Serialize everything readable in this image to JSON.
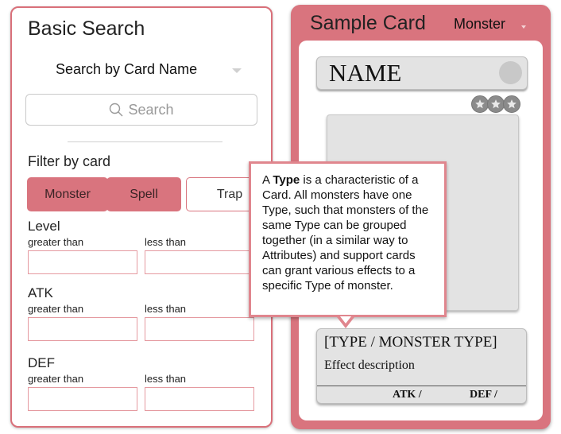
{
  "search_panel": {
    "title": "Basic Search",
    "search_mode": "Search by Card Name",
    "search_placeholder": "Search",
    "filter_label": "Filter by card",
    "filters": [
      {
        "label": "Monster",
        "active": true
      },
      {
        "label": "Spell",
        "active": true
      },
      {
        "label": "Trap",
        "active": false
      }
    ],
    "ranges": [
      {
        "label": "Level",
        "min_label": "greater than",
        "max_label": "less than",
        "min_value": "",
        "max_value": ""
      },
      {
        "label": "ATK",
        "min_label": "greater than",
        "max_label": "less than",
        "min_value": "",
        "max_value": ""
      },
      {
        "label": "DEF",
        "min_label": "greater than",
        "max_label": "less than",
        "min_value": "",
        "max_value": ""
      }
    ]
  },
  "card_panel": {
    "title": "Sample Card",
    "card_kind": "Monster",
    "card": {
      "name": "NAME",
      "level_stars": 3,
      "type_line": "[TYPE / MONSTER TYPE]",
      "effect": "Effect description",
      "atk_label": "ATK /",
      "def_label": "DEF /"
    }
  },
  "tooltip": {
    "prefix": "A ",
    "term": "Type",
    "body": " is a characteristic of a Card. All monsters have one Type, such that monsters of the same Type can be grouped together (in a similar way to Attributes) and support cards can grant various effects to a specific Type of monster."
  },
  "colors": {
    "accent": "#d9747e",
    "accent_border": "#e0868e",
    "card_gray": "#e3e3e3"
  }
}
